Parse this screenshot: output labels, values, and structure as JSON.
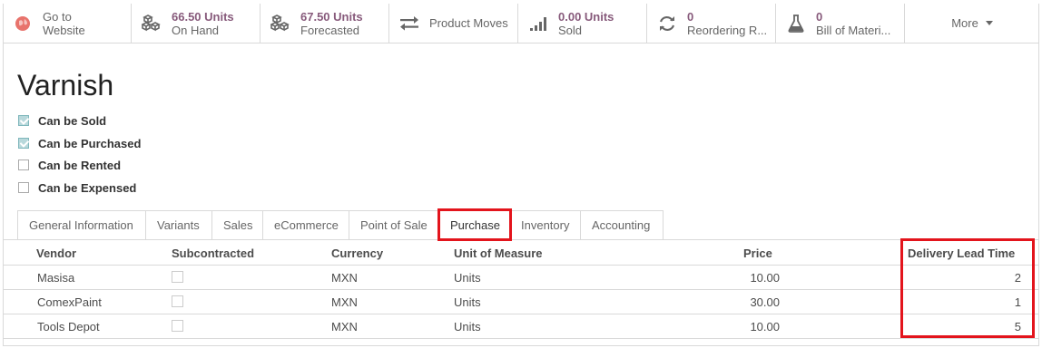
{
  "smart_buttons": [
    {
      "value": "",
      "label": "Go to",
      "label2": "Website",
      "icon": "globe-icon",
      "icon_color": "#e8736c"
    },
    {
      "value": "66.50 Units",
      "label": "On Hand",
      "icon": "cubes-icon"
    },
    {
      "value": "67.50 Units",
      "label": "Forecasted",
      "icon": "cubes-icon"
    },
    {
      "value": "",
      "label": "Product Moves",
      "icon": "exchange-icon"
    },
    {
      "value": "0.00 Units",
      "label": "Sold",
      "icon": "signal-icon"
    },
    {
      "value": "0",
      "label": "Reordering R...",
      "icon": "refresh-icon"
    },
    {
      "value": "0",
      "label": "Bill of Materi...",
      "icon": "flask-icon"
    }
  ],
  "more_label": "More",
  "product": {
    "name": "Varnish"
  },
  "options": [
    {
      "label": "Can be Sold",
      "checked": true
    },
    {
      "label": "Can be Purchased",
      "checked": true
    },
    {
      "label": "Can be Rented",
      "checked": false
    },
    {
      "label": "Can be Expensed",
      "checked": false
    }
  ],
  "tabs": [
    {
      "label": "General Information"
    },
    {
      "label": "Variants"
    },
    {
      "label": "Sales"
    },
    {
      "label": "eCommerce"
    },
    {
      "label": "Point of Sale"
    },
    {
      "label": "Purchase",
      "active": true
    },
    {
      "label": "Inventory"
    },
    {
      "label": "Accounting"
    }
  ],
  "table": {
    "columns": [
      "Vendor",
      "Subcontracted",
      "Currency",
      "Unit of Measure",
      "Price",
      "Delivery Lead Time"
    ],
    "rows": [
      {
        "vendor": "Masisa",
        "subcontracted": false,
        "currency": "MXN",
        "uom": "Units",
        "price": "10.00",
        "lead_time": "2"
      },
      {
        "vendor": "ComexPaint",
        "subcontracted": false,
        "currency": "MXN",
        "uom": "Units",
        "price": "30.00",
        "lead_time": "1"
      },
      {
        "vendor": "Tools Depot",
        "subcontracted": false,
        "currency": "MXN",
        "uom": "Units",
        "price": "10.00",
        "lead_time": "5"
      }
    ]
  },
  "colors": {
    "accent": "#875a7b",
    "highlight": "#e3141c",
    "border": "#d9d9d9"
  }
}
